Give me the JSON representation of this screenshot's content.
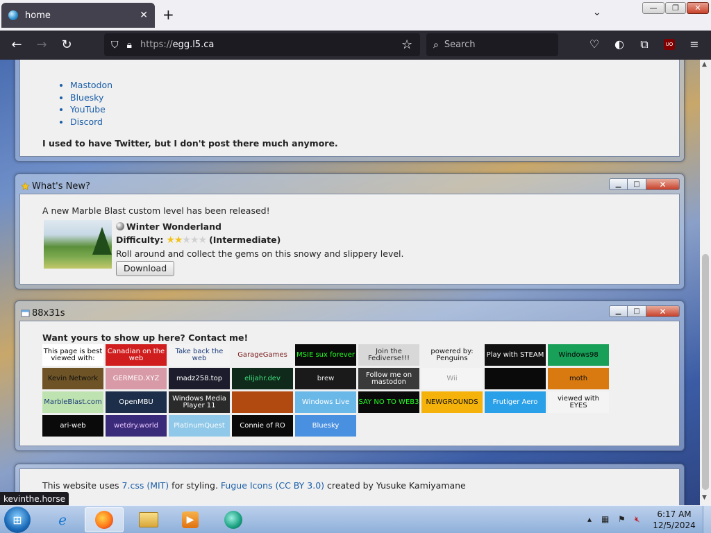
{
  "browser": {
    "tab_title": "home",
    "tab_close": "✕",
    "new_tab": "+",
    "tab_list": "⌄",
    "url_scheme": "https://",
    "url_host": "egg.l5.ca",
    "search_placeholder": "Search",
    "window_buttons": {
      "minimize": "—",
      "restore": "❐",
      "close": "✕"
    }
  },
  "page": {
    "social_links": [
      "Mastodon",
      "Bluesky",
      "YouTube",
      "Discord"
    ],
    "twitter_note": "I used to have Twitter, but I don't post there much anymore.",
    "whats_new": {
      "title": "What's New?",
      "announcement": "A new Marble Blast custom level has been released!",
      "level_name": "Winter Wonderland",
      "difficulty_label": "Difficulty:",
      "difficulty_stars": 2,
      "difficulty_max": 5,
      "difficulty_text": "(Intermediate)",
      "description": "Roll around and collect the gems on this snowy and slippery level.",
      "download_label": "Download"
    },
    "buttons_window": {
      "title": "88x31s",
      "heading": "Want yours to show up here? Contact me!",
      "buttons": [
        {
          "text": "This page is best viewed with:",
          "bg": "#ffffff",
          "fg": "#000000"
        },
        {
          "text": "Canadian on the web",
          "bg": "#d01e1e",
          "fg": "#ffffff"
        },
        {
          "text": "Take back the web",
          "bg": "#f3f3f3",
          "fg": "#1a3a7a"
        },
        {
          "text": "GarageGames",
          "bg": "#f0f0f0",
          "fg": "#7a1a1a"
        },
        {
          "text": "MSIE sux forever",
          "bg": "#0a0a0a",
          "fg": "#22ff22"
        },
        {
          "text": "Join the Fediverse!!!",
          "bg": "#d8d8d8",
          "fg": "#222222"
        },
        {
          "text": "powered by: Penguins",
          "bg": "#f0f0f0",
          "fg": "#111111"
        },
        {
          "text": "Play with STEAM",
          "bg": "#111111",
          "fg": "#ffffff"
        },
        {
          "text": "Windows98",
          "bg": "#18a058",
          "fg": "#000000"
        },
        {
          "text": "Kevin Network",
          "bg": "#6d5326",
          "fg": "#111111"
        },
        {
          "text": "GERMED.XYZ",
          "bg": "#d89aa6",
          "fg": "#ffffff"
        },
        {
          "text": "madz258.top",
          "bg": "#1c1c2c",
          "fg": "#ffffff"
        },
        {
          "text": "elijahr.dev",
          "bg": "#0f2a1a",
          "fg": "#3fe07f"
        },
        {
          "text": "brew",
          "bg": "#1a1a1a",
          "fg": "#eeeeee"
        },
        {
          "text": "Follow me on mastodon",
          "bg": "#3a3a3a",
          "fg": "#ffffff"
        },
        {
          "text": "Wii",
          "bg": "#f4f4f4",
          "fg": "#999999"
        },
        {
          "text": "",
          "bg": "#0a0a0a",
          "fg": "#ffffff"
        },
        {
          "text": "moth",
          "bg": "#d87a10",
          "fg": "#111111"
        },
        {
          "text": "MarbleBlast.com",
          "bg": "#bfe3b0",
          "fg": "#1a3a7a"
        },
        {
          "text": "OpenMBU",
          "bg": "#1c2e4a",
          "fg": "#ffffff"
        },
        {
          "text": "Windows Media Player 11",
          "bg": "#2a2a2a",
          "fg": "#ffffff"
        },
        {
          "text": "",
          "bg": "#b04a10",
          "fg": "#ffffff"
        },
        {
          "text": "Windows Live",
          "bg": "#6ab8e8",
          "fg": "#ffffff"
        },
        {
          "text": "SAY NO TO WEB3",
          "bg": "#0a0a0a",
          "fg": "#22ff22"
        },
        {
          "text": "NEWGROUNDS",
          "bg": "#f4b20a",
          "fg": "#111111"
        },
        {
          "text": "Frutiger Aero",
          "bg": "#2aa0e8",
          "fg": "#ffffff"
        },
        {
          "text": "viewed with EYES",
          "bg": "#f4f4f4",
          "fg": "#111111"
        },
        {
          "text": "ari-web",
          "bg": "#0a0a0a",
          "fg": "#ffffff"
        },
        {
          "text": "wetdry.world",
          "bg": "#3a2a7a",
          "fg": "#e8c8ff"
        },
        {
          "text": "PlatinumQuest",
          "bg": "#8fc8e8",
          "fg": "#ffffff"
        },
        {
          "text": "Connie of RO",
          "bg": "#0a0a0a",
          "fg": "#ffffff"
        },
        {
          "text": "Bluesky",
          "bg": "#4a90e0",
          "fg": "#ffffff"
        }
      ]
    },
    "footer": {
      "pre": "This website uses ",
      "link1": "7.css (MIT)",
      "mid": " for styling. ",
      "link2": "Fugue Icons (CC BY 3.0)",
      "post": " created by Yusuke Kamiyamane"
    }
  },
  "status_url": "kevinthe.horse",
  "taskbar": {
    "time": "6:17 AM",
    "date": "12/5/2024"
  }
}
